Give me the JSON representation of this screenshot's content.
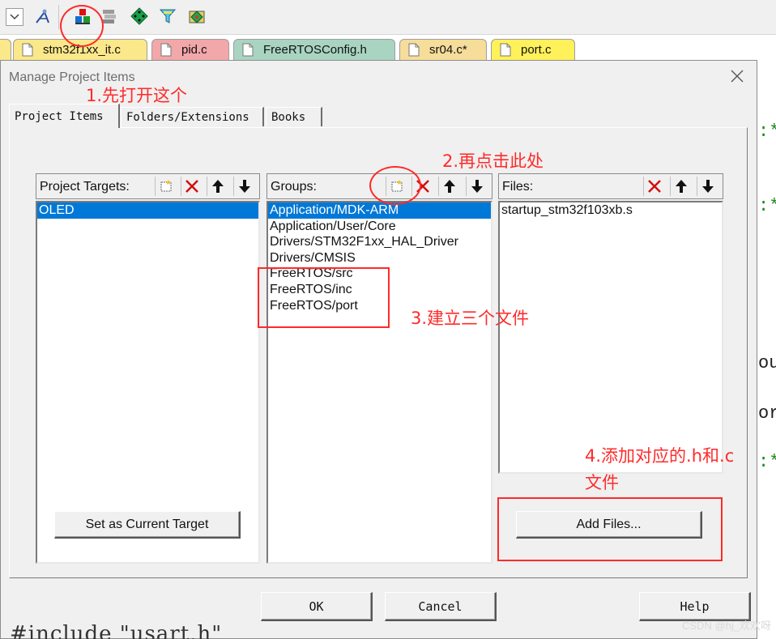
{
  "editor_tabs": [
    {
      "label": "stm32f1xx_it.c",
      "color": "#fbe88a"
    },
    {
      "label": "pid.c",
      "color": "#f2a7a9"
    },
    {
      "label": "FreeRTOSConfig.h",
      "color": "#a9d4c2"
    },
    {
      "label": "sr04.c*",
      "color": "#f6dd9a"
    },
    {
      "label": "port.c",
      "color": "#fff15a"
    }
  ],
  "toolbar": {
    "icons": [
      "dropdown-icon",
      "wand-icon",
      "manage-project-items-icon",
      "stack-icon",
      "diamond-icon",
      "funnel-icon",
      "pack-icon"
    ]
  },
  "dialog": {
    "title": "Manage Project Items",
    "tabs": [
      "Project Items",
      "Folders/Extensions",
      "Books"
    ],
    "targets": {
      "label": "Project Targets:",
      "items": [
        "OLED"
      ],
      "selected_index": 0
    },
    "groups": {
      "label": "Groups:",
      "items": [
        "Application/MDK-ARM",
        "Application/User/Core",
        "Drivers/STM32F1xx_HAL_Driver",
        "Drivers/CMSIS",
        "FreeRTOS/src",
        "FreeRTOS/inc",
        "FreeRTOS/port"
      ],
      "selected_index": 0
    },
    "files": {
      "label": "Files:",
      "items": [
        "startup_stm32f103xb.s"
      ]
    },
    "set_target_button": "Set as Current Target",
    "add_files_button": "Add Files...",
    "ok_button": "OK",
    "cancel_button": "Cancel",
    "help_button": "Help"
  },
  "annotations": {
    "step1": "1.先打开这个",
    "step2": "2.再点击此处",
    "step3": "3.建立三个文件",
    "step4_line1": "4.添加对应的.h和.c",
    "step4_line2": "文件",
    "color": "#ff2a2a"
  },
  "background_code": {
    "frag1": ":*",
    "frag2": ":*",
    "frag3": "ou",
    "frag4": "or",
    "frag5": ":*",
    "bottom": "#include \"usart.h\""
  },
  "watermark": "CSDN @hj_欢欢呀"
}
